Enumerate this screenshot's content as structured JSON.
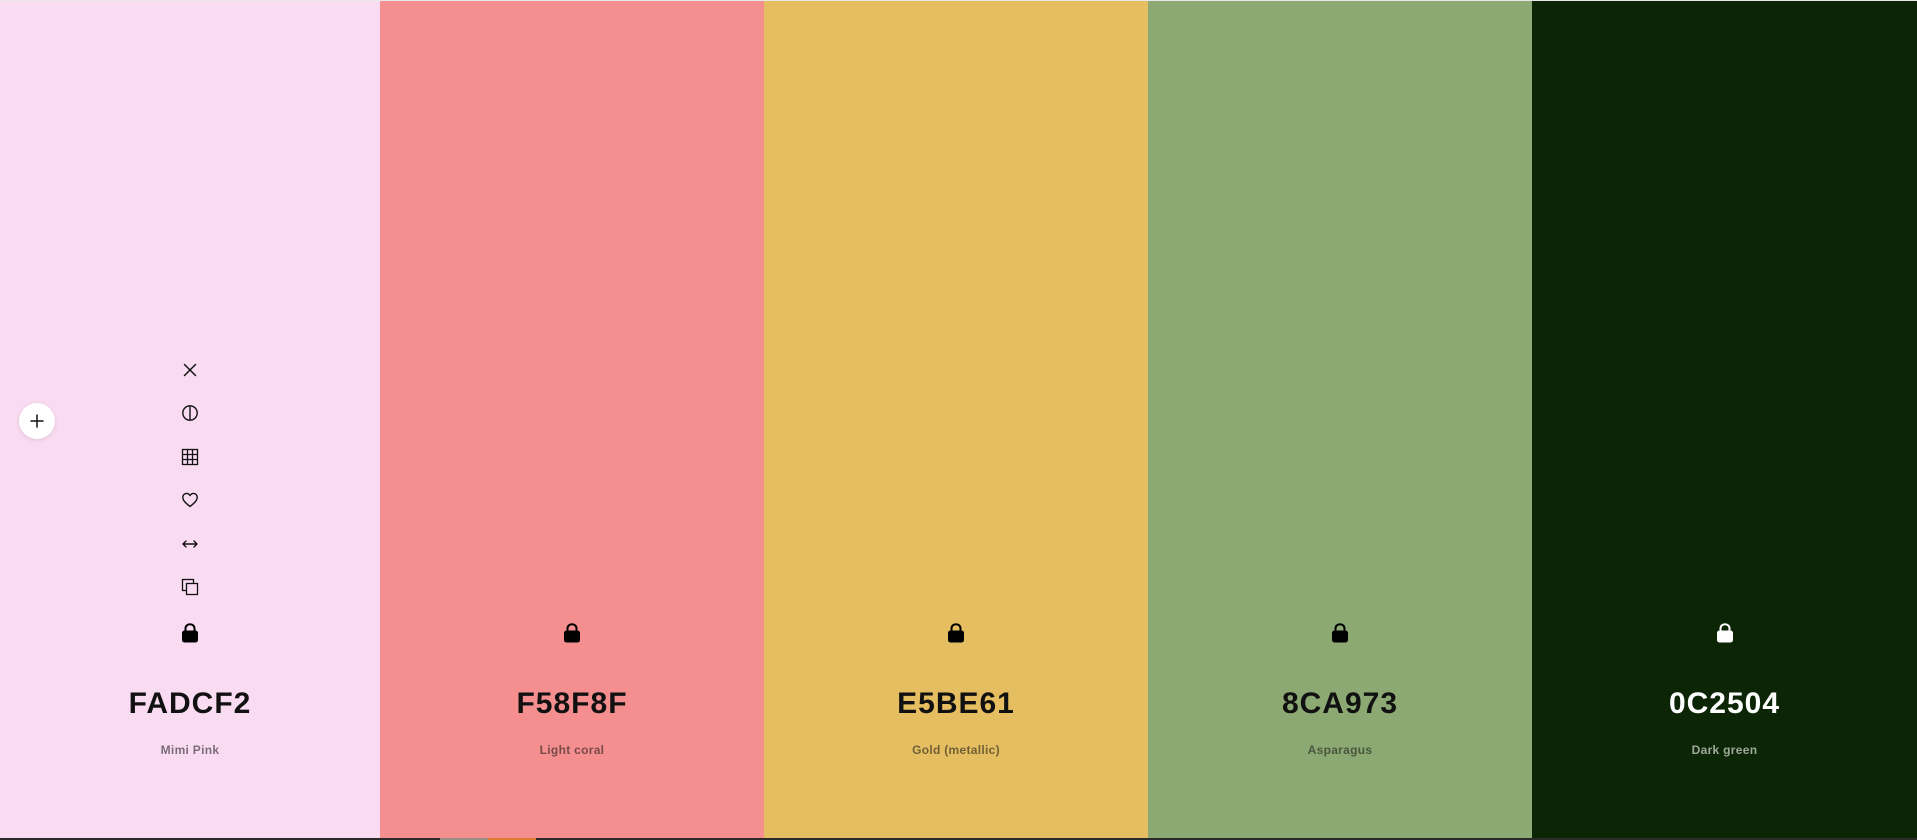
{
  "palette": {
    "colors": [
      {
        "hex": "FADCF2",
        "name": "Mimi Pink",
        "bg": "#FADCF2",
        "text_color": "#111111"
      },
      {
        "hex": "F58F8F",
        "name": "Light coral",
        "bg": "#F58F8F",
        "text_color": "#111111"
      },
      {
        "hex": "E5BE61",
        "name": "Gold (metallic)",
        "bg": "#E5BE61",
        "text_color": "#111111"
      },
      {
        "hex": "8CA973",
        "name": "Asparagus",
        "bg": "#8CA973",
        "text_color": "#111111"
      },
      {
        "hex": "0C2504",
        "name": "Dark green",
        "bg": "#0C2504",
        "text_color": "#FFFFFF"
      }
    ]
  },
  "toolbar": {
    "icons": [
      "close-icon",
      "contrast-icon",
      "grid-icon",
      "heart-icon",
      "arrows-horizontal-icon",
      "copy-icon"
    ]
  },
  "add_button": {
    "icon": "plus-icon"
  }
}
